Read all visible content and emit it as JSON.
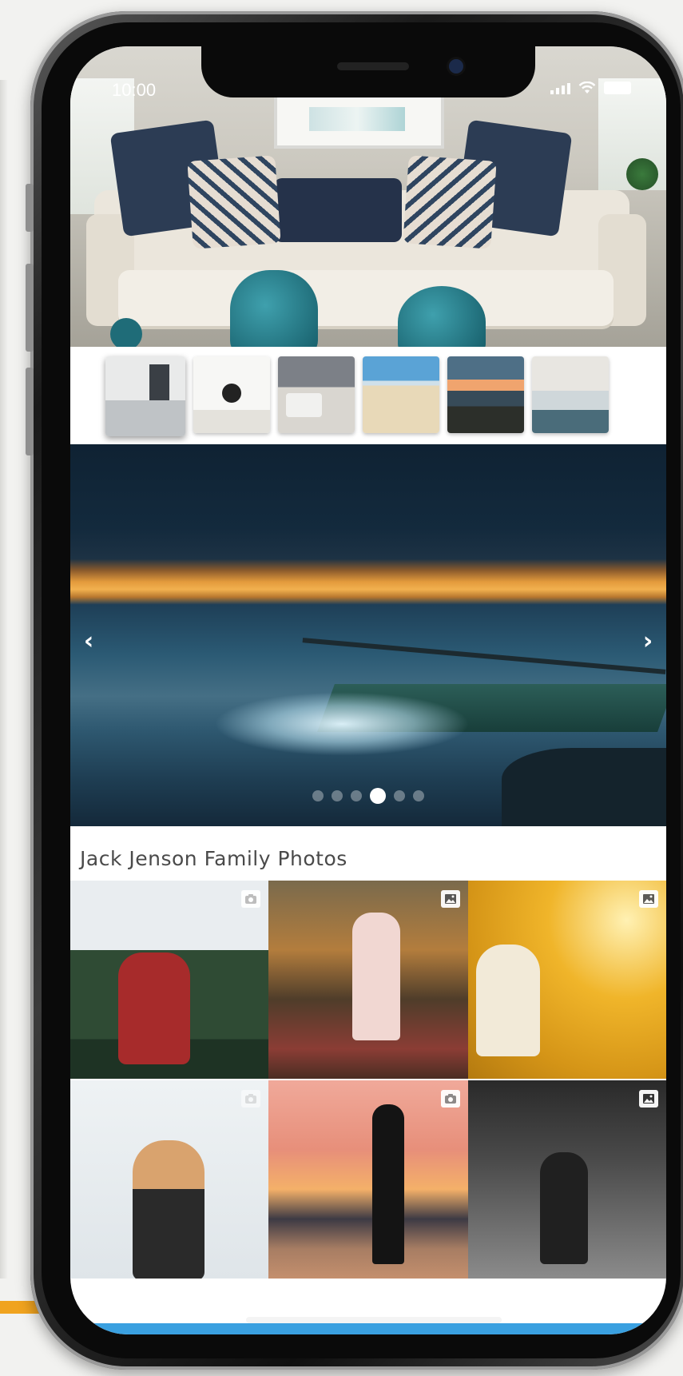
{
  "status_bar": {
    "time": "10:00"
  },
  "hero": {
    "selected_thumbnail": 0
  },
  "thumbnails": [
    {
      "name": "bathroom"
    },
    {
      "name": "entryway"
    },
    {
      "name": "bedroom-dark"
    },
    {
      "name": "beach"
    },
    {
      "name": "sunset-pier"
    },
    {
      "name": "bedroom-light"
    }
  ],
  "carousel": {
    "prev_icon": "‹",
    "next_icon": "›",
    "slide_count": 6,
    "active_slide": 3
  },
  "gallery": {
    "title": "Jack Jenson Family Photos",
    "items": [
      {
        "type_icon": "camera-icon"
      },
      {
        "type_icon": "image-icon"
      },
      {
        "type_icon": "image-icon"
      },
      {
        "type_icon": "camera-icon"
      },
      {
        "type_icon": "camera-icon"
      },
      {
        "type_icon": "image-icon"
      }
    ]
  }
}
